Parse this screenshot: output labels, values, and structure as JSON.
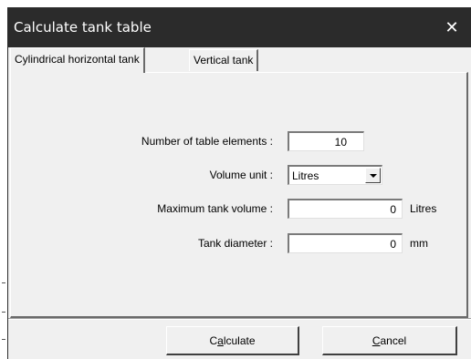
{
  "window": {
    "title": "Calculate tank table",
    "close_glyph": "✕"
  },
  "tabs": [
    {
      "label": "Cylindrical horizontal tank",
      "active": true
    },
    {
      "label": "Vertical tank",
      "active": false
    }
  ],
  "form": {
    "elements": {
      "label": "Number of table elements :",
      "value": "10"
    },
    "volume_unit": {
      "label": "Volume unit :",
      "value": "Litres"
    },
    "max_volume": {
      "label": "Maximum tank volume :",
      "value": "0",
      "unit": "Litres"
    },
    "diameter": {
      "label": "Tank diameter :",
      "value": "0",
      "unit": "mm"
    }
  },
  "buttons": {
    "calculate": {
      "before": "C",
      "mnemonic": "a",
      "after": "lculate"
    },
    "cancel": {
      "before": "",
      "mnemonic": "C",
      "after": "ancel"
    }
  },
  "icons": {
    "close": "close-icon",
    "dropdown": "chevron-down-icon"
  },
  "colors": {
    "titlebar": "#2b2b2b",
    "dialog_bg": "#f0f0f0",
    "field_bg": "#ffffff"
  }
}
